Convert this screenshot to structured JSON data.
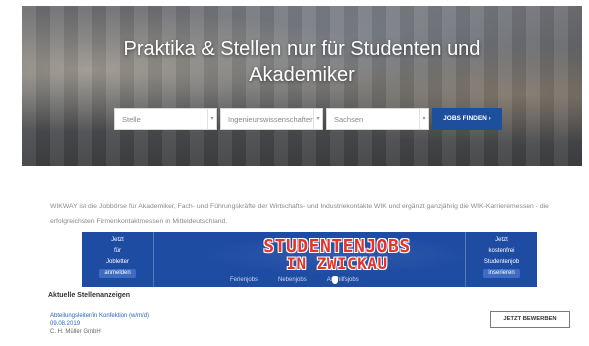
{
  "hero": {
    "title_line1": "Praktika & Stellen nur für Studenten und",
    "title_line2": "Akademiker",
    "search": {
      "field1_value": "Stelle",
      "field2_value": "Ingenieurswissenschaften",
      "field3_value": "Sachsen",
      "submit_label": "JOBS FINDEN  ›"
    }
  },
  "intro": {
    "text": "WIKWAY ist die Jobbörse für Akademiker, Fach- und Führungskräfte der Wirtschafts- und Industriekontakte WIK und ergänzt ganzjährig die WIK-Karrieremessen - die erfolgreichsten Firmenkontaktmessen in Mitteldeutschland."
  },
  "banner": {
    "left": {
      "line1": "Jetzt",
      "line2": "für",
      "line3": "Jobletter",
      "action": "anmelden"
    },
    "center": {
      "title_line1": "STUDENTENJOBS",
      "title_line2": "IN ZWICKAU",
      "links": [
        "Ferienjobs",
        "Nebenjobs",
        "Aushilfsjobs"
      ]
    },
    "right": {
      "line1": "Jetzt",
      "line2": "kostenfrei",
      "line3": "Studentenjob",
      "action": "inserieren"
    }
  },
  "listings": {
    "section_title": "Aktuelle Stellenanzeigen",
    "items": [
      {
        "title": "Abteilungsleiter/in Konfektion (w/m/d)",
        "date": "09.08.2019",
        "company": "C. H. Müller GmbH"
      }
    ],
    "apply_label": "JETZT BEWERBEN"
  }
}
